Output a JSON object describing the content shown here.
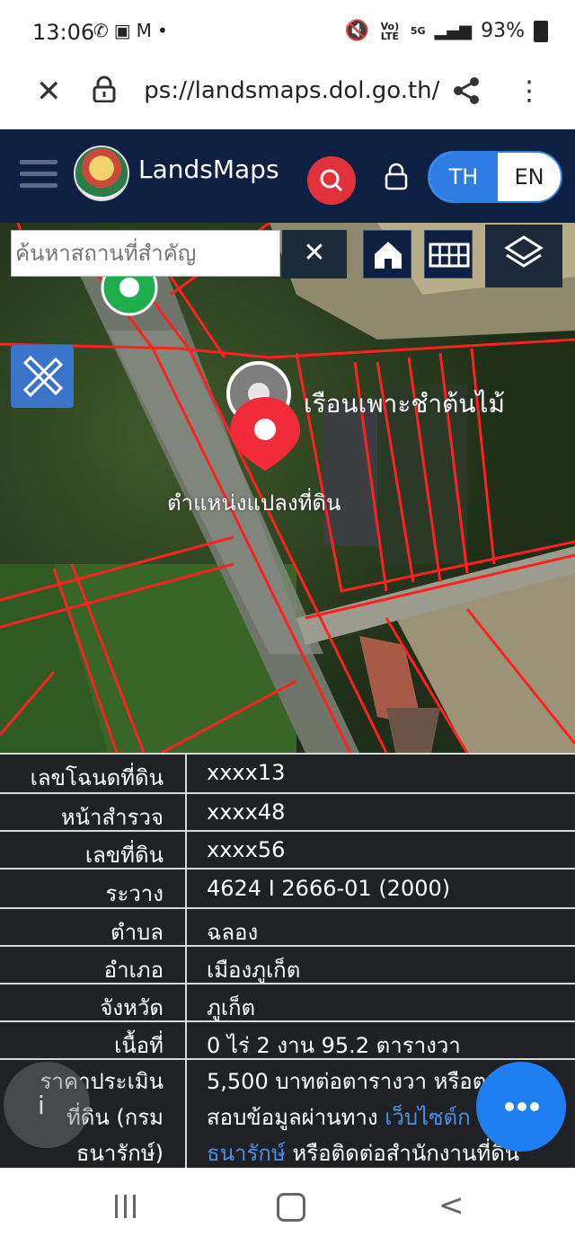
{
  "status_bar": {
    "time": "13:06",
    "volte": "Vo) LTE",
    "network": "5G",
    "battery": "93%"
  },
  "browser": {
    "url": " ps://landsmaps.dol.go.th/"
  },
  "header": {
    "brand": "LandsMaps",
    "lang_th": "TH",
    "lang_en": "EN"
  },
  "map": {
    "search_placeholder": "ค้นหาสถานที่สำคัญ",
    "clear_symbol": "✕",
    "place_label": "เรือนเพาะชำต้นไม้",
    "pin_label": "ตำแหน่งแปลงที่ดิน"
  },
  "land_info": {
    "rows": [
      {
        "label": "เลขโฉนดที่ดิน",
        "value": "xxxx13"
      },
      {
        "label": "หน้าสำรวจ",
        "value": "xxxx48"
      },
      {
        "label": "เลขที่ดิน",
        "value": "xxxx56"
      },
      {
        "label": "ระวาง",
        "value": "4624 I 2666-01 (2000)"
      },
      {
        "label": "ตำบล",
        "value": "ฉลอง"
      },
      {
        "label": "อำเภอ",
        "value": "เมืองภูเก็ต"
      },
      {
        "label": "จังหวัด",
        "value": "ภูเก็ต"
      },
      {
        "label": "เนื้อที่",
        "value": "0 ไร่ 2 งาน 95.2 ตารางวา"
      }
    ],
    "price": {
      "label_line1": "ราคาประเมิน",
      "label_line2": "ที่ดิน (กรม",
      "label_line3": "ธนารักษ์)",
      "value_line1": "5,500 บาทต่อตารางวา หรือต",
      "value_line2_text": "สอบข้อมูลผ่านทาง ",
      "value_line2_link": "เว็บไซต์ก",
      "value_line3_link": "ธนารักษ์",
      "value_line3_text": " หรือติดต่อสำนักงานที่ดิน"
    }
  },
  "colors": {
    "header": "#0e2042",
    "accent_red": "#e0323a",
    "toggle_blue": "#2f7de2",
    "parcel_line": "#ff2020"
  }
}
